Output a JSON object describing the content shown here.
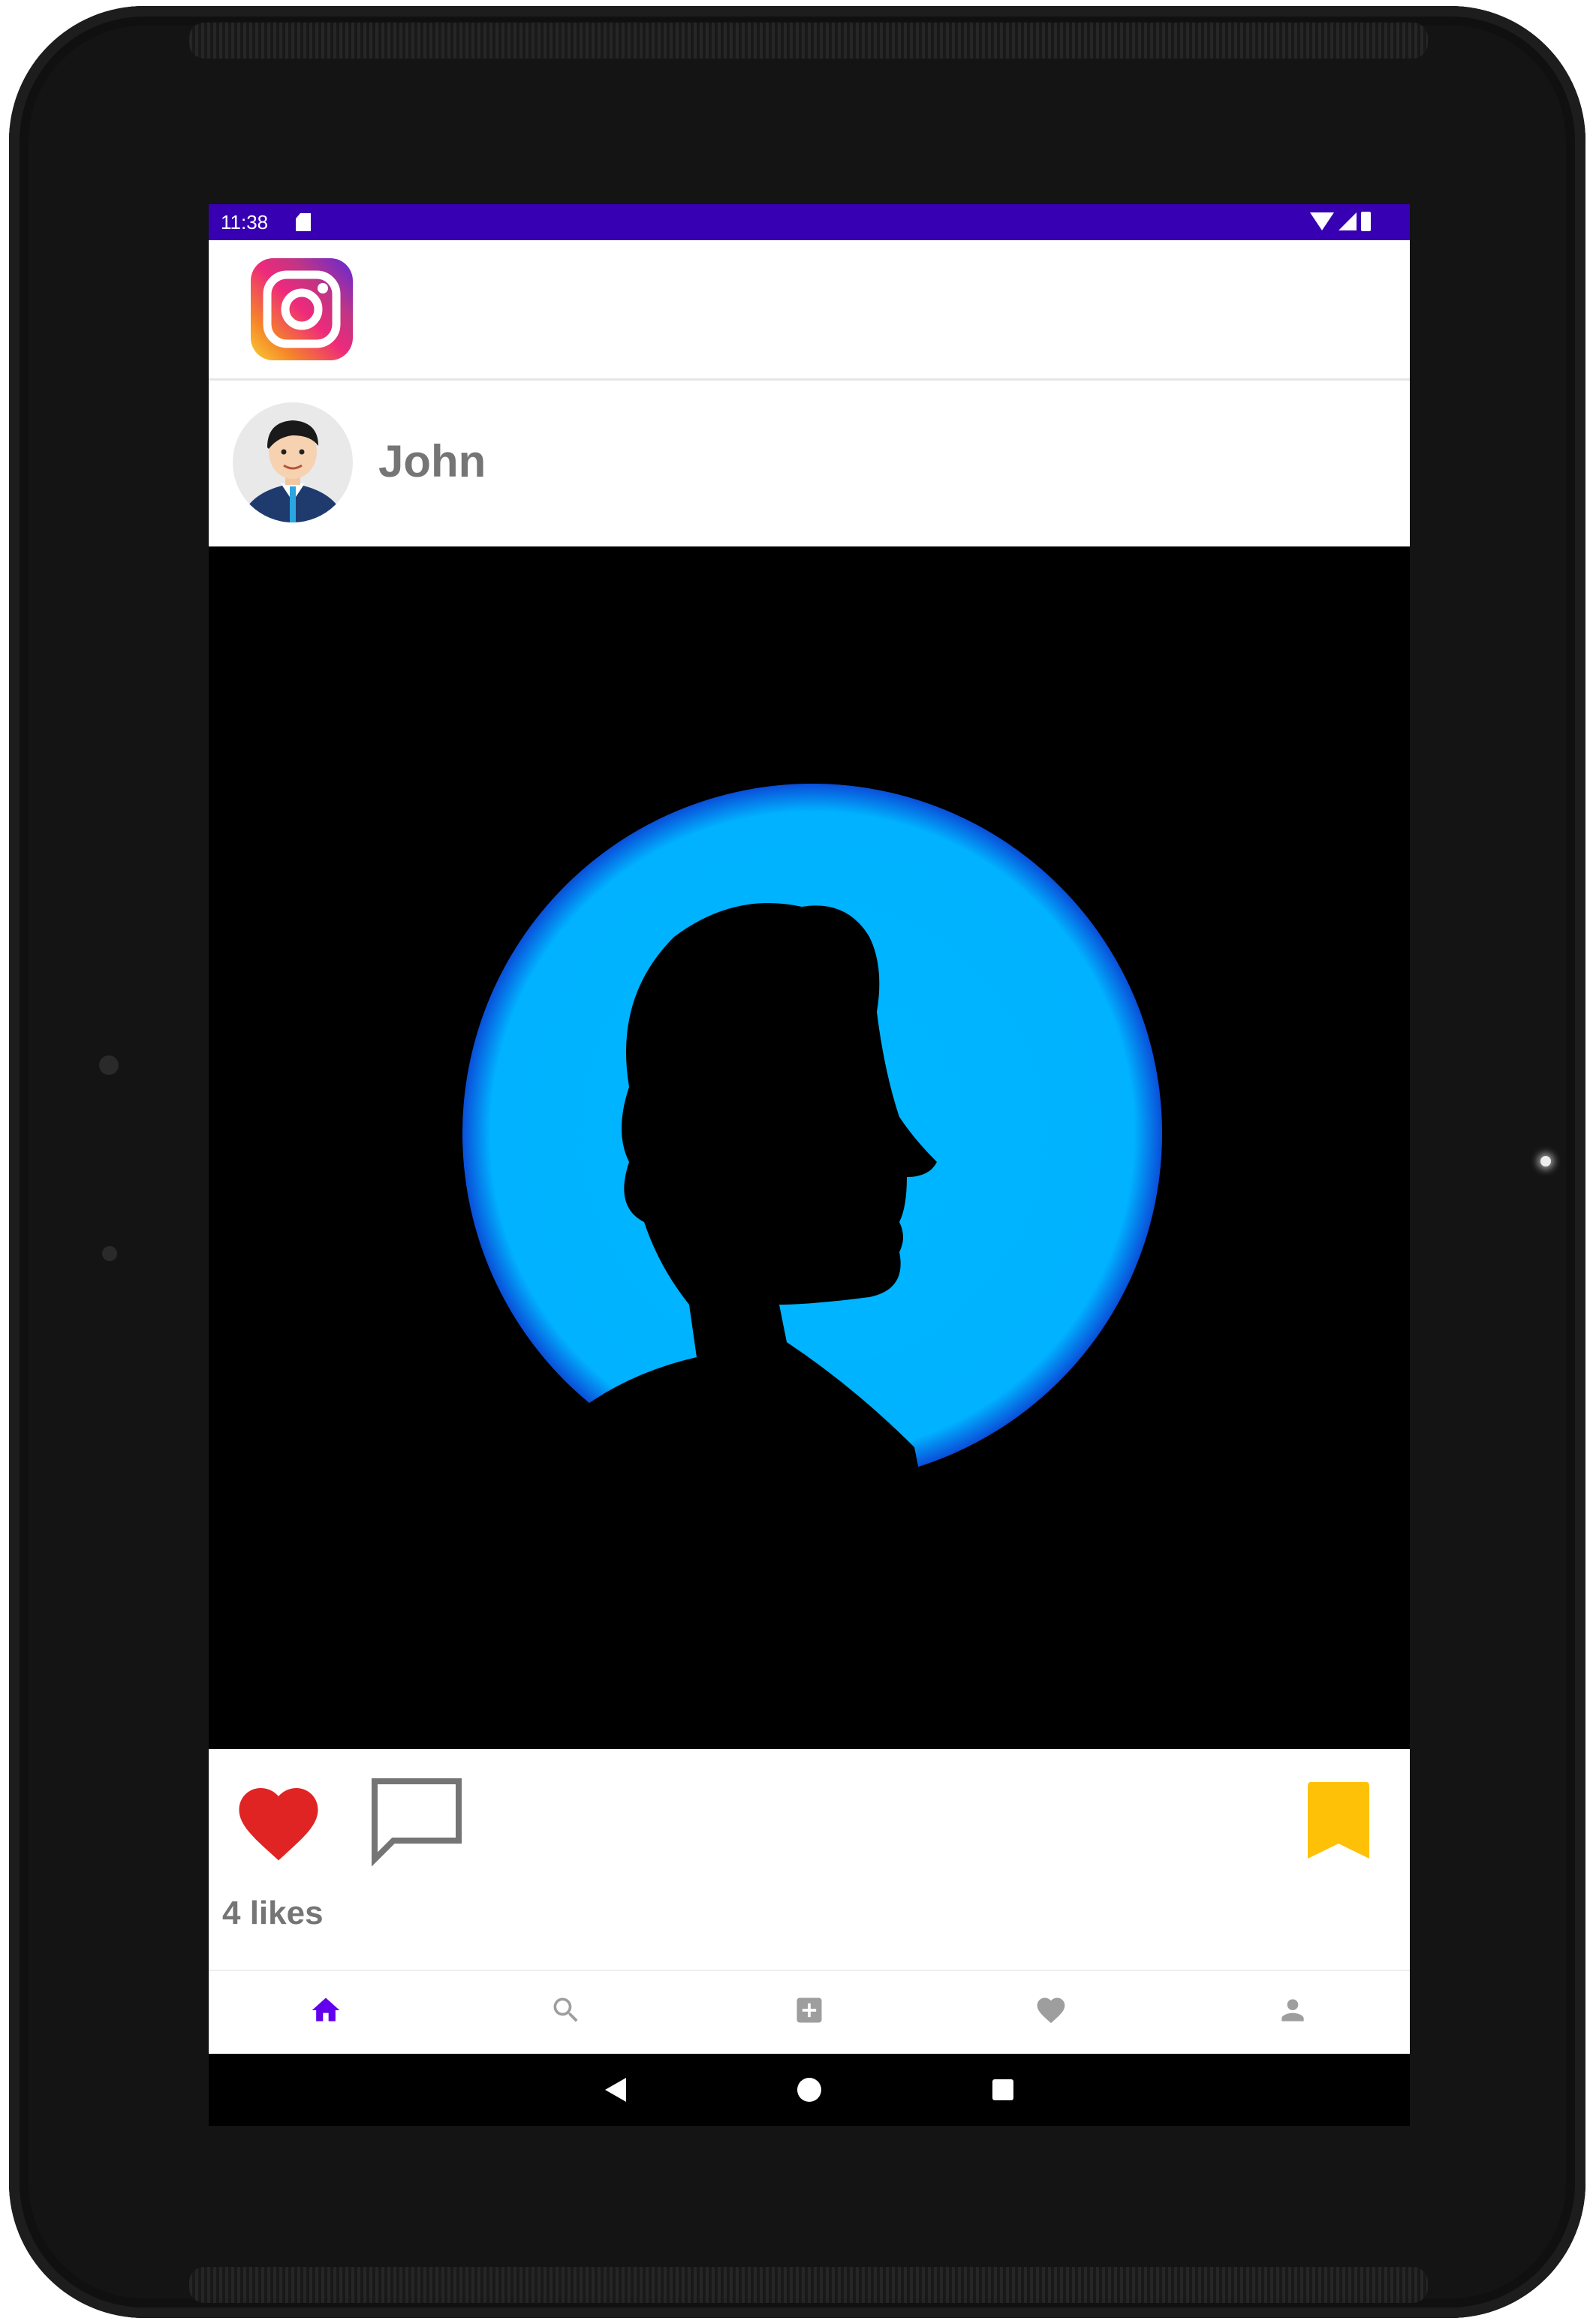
{
  "status_bar": {
    "time": "11:38"
  },
  "post": {
    "username": "John",
    "likes": "4 likes",
    "liked": true,
    "saved": true
  },
  "icons": {
    "app_logo": "instagram-logo",
    "like": "heart-icon",
    "comment": "comment-icon",
    "save": "bookmark-icon"
  },
  "bottom_nav": {
    "items": [
      "home-icon",
      "search-icon",
      "add-box-icon",
      "heart-icon",
      "person-icon"
    ],
    "active": "home-icon"
  },
  "colors": {
    "status_bar": "#3700b3",
    "accent": "#6200ee",
    "like": "#e02424",
    "bookmark": "#ffc107",
    "inactive_icon": "#9e9e9e",
    "username_text": "#757575"
  }
}
